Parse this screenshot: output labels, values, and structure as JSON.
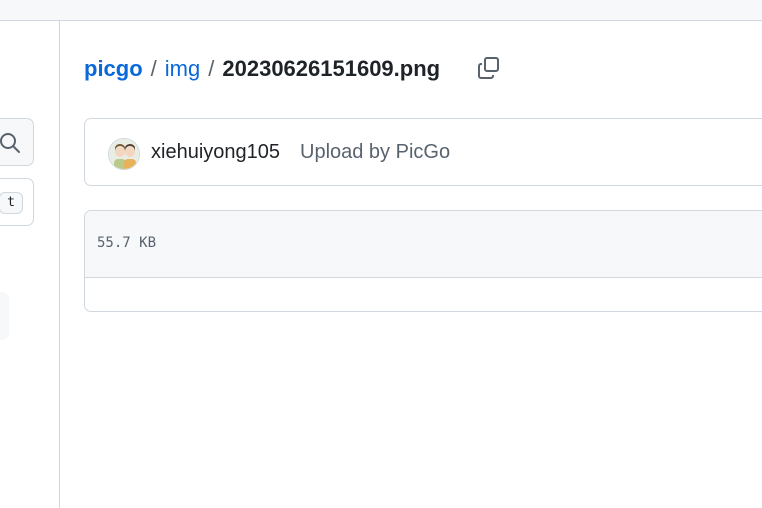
{
  "breadcrumb": {
    "repo": "picgo",
    "folder": "img",
    "separator": "/",
    "file": "20230626151609.png"
  },
  "icons": {
    "copy": "copy-icon",
    "search": "search-icon",
    "avatar": "avatar-image"
  },
  "sidebar": {
    "shortcut_key": "t"
  },
  "commit": {
    "author": "xiehuiyong105",
    "message": "Upload by PicGo"
  },
  "file": {
    "size": "55.7 KB"
  },
  "colors": {
    "link": "#0969da",
    "muted": "#59636e",
    "border": "#d0d7de",
    "header_bg": "#f6f8fa"
  }
}
